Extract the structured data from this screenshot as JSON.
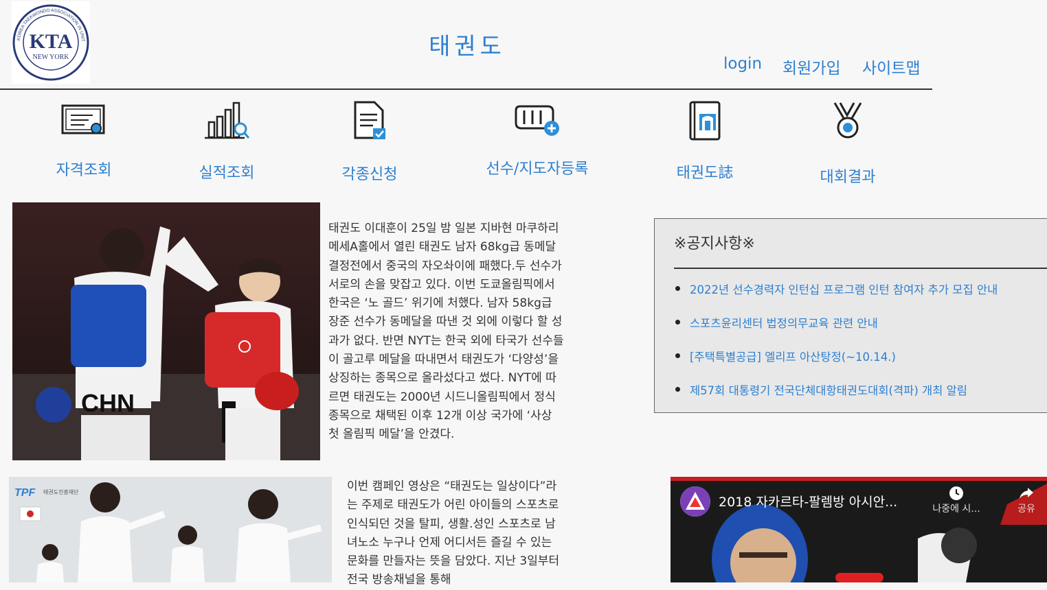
{
  "header": {
    "logo": {
      "text_top": "KOREA TAEKWONDO ASSOCIATION IN UNITED STATES OF AMERICA",
      "monogram": "KTA",
      "city": "NEW YORK"
    },
    "site_title": "태권도",
    "nav": {
      "login": "login",
      "signup": "회원가입",
      "sitemap": "사이트맵"
    }
  },
  "menu": [
    {
      "label": "자격조회",
      "icon": "certificate-icon"
    },
    {
      "label": "실적조회",
      "icon": "chart-search-icon"
    },
    {
      "label": "각종신청",
      "icon": "document-check-icon"
    },
    {
      "label": "선수/지도자등록",
      "icon": "fist-add-icon"
    },
    {
      "label": "태권도誌",
      "icon": "book-icon"
    },
    {
      "label": "대회결과",
      "icon": "medal-icon"
    }
  ],
  "article1": {
    "photo_text": "CHN",
    "text": "태권도 이대훈이 25일 밤 일본 지바현 마쿠하리 메세A홀에서 열린 태권도 남자 68kg급 동메달 결정전에서 중국의 자오솨이에 패했다.두 선수가 서로의 손을 맞잡고 있다. 이번 도쿄올림픽에서 한국은 ‘노 골드’ 위기에 처했다. 남자 58kg급 장준 선수가 동메달을 따낸 것 외에 이렇다 할 성과가 없다. 반면 NYT는 한국 외에 타국가 선수들이 골고루 메달을 따내면서 태권도가 ‘다양성’을 상징하는 종목으로 올라섰다고 썼다. NYT에 따르면 태권도는 2000년 시드니올림픽에서 정식 종목으로 채택된 이후 12개 이상 국가에 ‘사상 첫 올림픽 메달’을 안겼다."
  },
  "notice": {
    "title": "※공지사항※",
    "items": [
      "2022년 선수경력자 인턴십 프로그램 인턴 참여자 추가 모집 안내",
      "스포츠윤리센터 법정의무교육 관련 안내",
      "[주택특별공급] 엘리프 아산탕정(~10.14.)",
      "제57회 대통령기 전국단체대항태권도대회(격파) 개최 알림"
    ]
  },
  "article2": {
    "photo_logo": "TPF",
    "photo_org": "태권도진흥재단",
    "text": "이번 캠페인 영상은 “태권도는 일상이다”라는 주제로 태권도가 어린 아이들의 스포츠로 인식되던 것을 탈피, 생활.성인 스포츠로 남녀노소 누구나 언제 어디서든 즐길 수 있는 문화를 만들자는 뜻을 담았다. 지난 3일부터 전국 방송채널을 통해"
  },
  "video": {
    "title": "2018 자카르타-팔렘방 아시안...",
    "later": "나중에 시...",
    "share": "공유"
  },
  "colors": {
    "accent": "#2d7fd0",
    "background": "#f7f7f7",
    "notice_bg": "#e8e8e8"
  }
}
